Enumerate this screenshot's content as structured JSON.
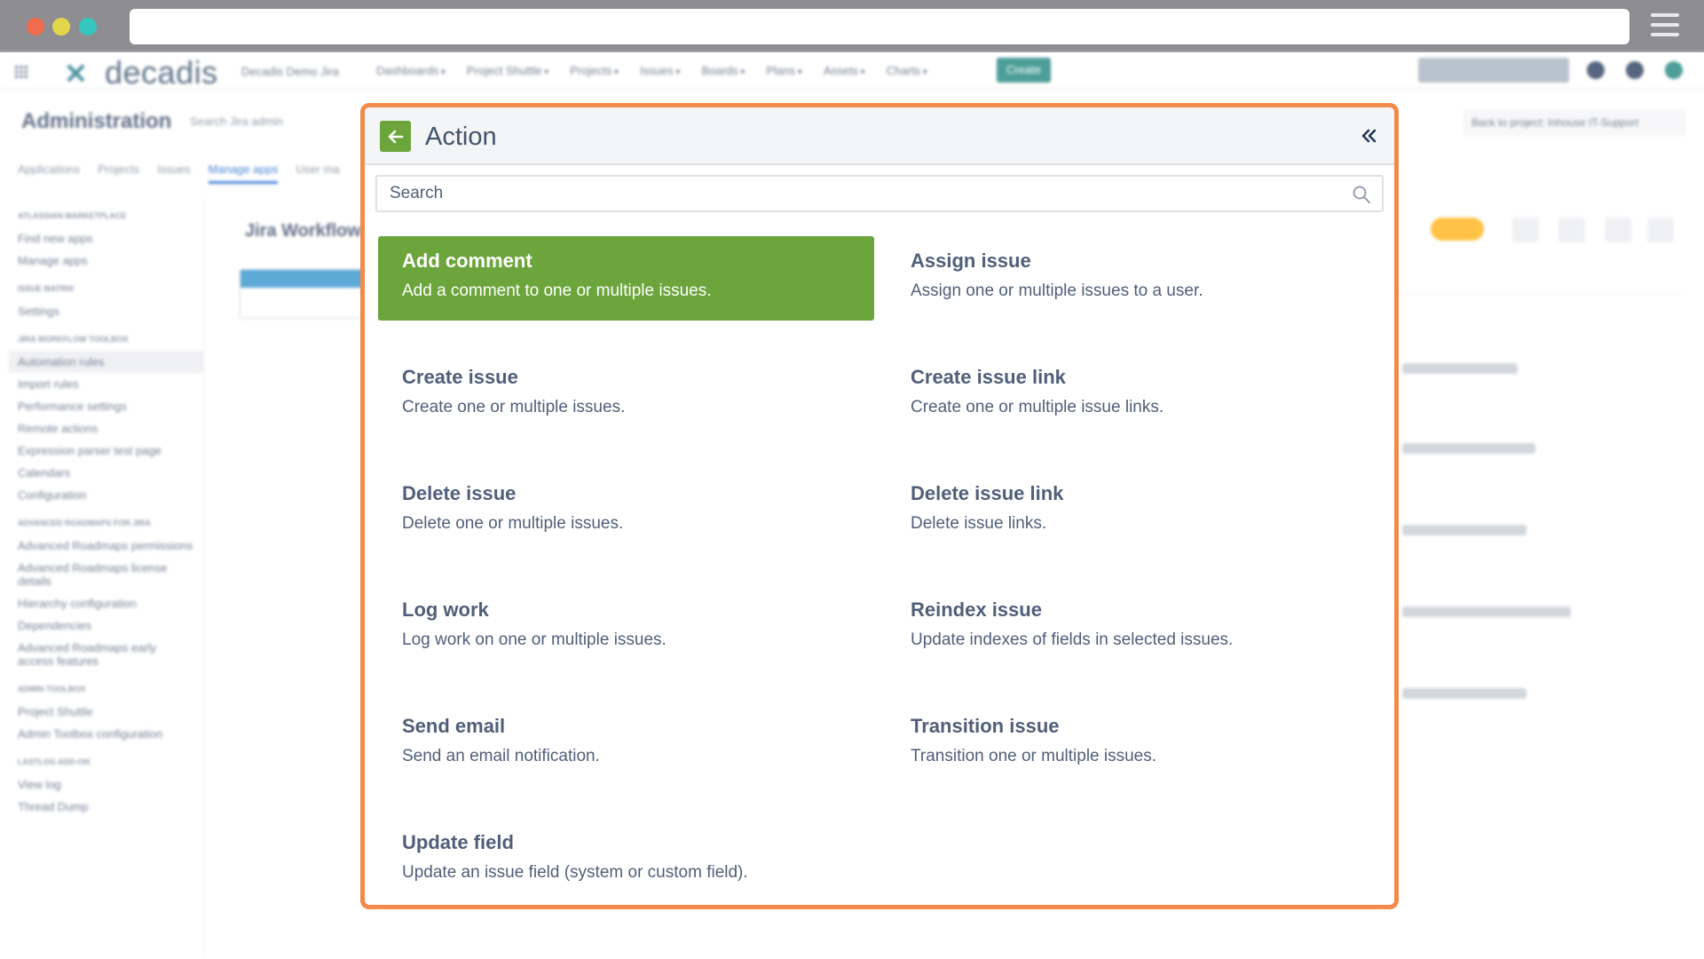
{
  "browser": {
    "window_controls": [
      "close",
      "minimize",
      "maximize"
    ],
    "url": "",
    "menu_icon": "hamburger-icon"
  },
  "background_app": {
    "logo_text": "decadis",
    "site_name": "Decadis Demo Jira",
    "nav": [
      "Dashboards",
      "Project Shuttle",
      "Projects",
      "Issues",
      "Boards",
      "Plans",
      "Assets",
      "Charts"
    ],
    "create_label": "Create",
    "admin_title": "Administration",
    "admin_search": "Search Jira admin",
    "admin_tabs": [
      "Applications",
      "Projects",
      "Issues",
      "Manage apps",
      "User ma"
    ],
    "back_to_project": "Back to project: Inhouse IT-Support",
    "workflow_title": "Jira Workflow",
    "sidebar": [
      {
        "heading": "ATLASSIAN MARKETPLACE",
        "items": [
          "Find new apps",
          "Manage apps"
        ]
      },
      {
        "heading": "ISSUE MATRIX",
        "items": [
          "Settings"
        ]
      },
      {
        "heading": "JIRA WORKFLOW TOOLBOX",
        "items": [
          "Automation rules",
          "Import rules",
          "Performance settings",
          "Remote actions",
          "Expression parser test page",
          "Calendars",
          "Configuration"
        ]
      },
      {
        "heading": "ADVANCED ROADMAPS FOR JIRA",
        "items": [
          "Advanced Roadmaps permissions",
          "Advanced Roadmaps license details",
          "Hierarchy configuration",
          "Dependencies",
          "Advanced Roadmaps early access features"
        ]
      },
      {
        "heading": "ADMIN TOOLBOX",
        "items": [
          "Project Shuttle",
          "Admin Toolbox configuration"
        ]
      },
      {
        "heading": "LASTLOG ADD-ON",
        "items": [
          "View log",
          "Thread Dump"
        ]
      }
    ]
  },
  "modal": {
    "title": "Action",
    "search_placeholder": "Search",
    "accent_color": "#6ba53b",
    "highlight_border_color": "#f28a4b",
    "actions": [
      {
        "name": "Add comment",
        "description": "Add a comment to one or multiple issues.",
        "selected": true
      },
      {
        "name": "Assign issue",
        "description": "Assign one or multiple issues to a user."
      },
      {
        "name": "Create issue",
        "description": "Create one or multiple issues."
      },
      {
        "name": "Create issue link",
        "description": "Create one or multiple issue links."
      },
      {
        "name": "Delete issue",
        "description": "Delete one or multiple issues."
      },
      {
        "name": "Delete issue link",
        "description": "Delete issue links."
      },
      {
        "name": "Log work",
        "description": "Log work on one or multiple issues."
      },
      {
        "name": "Reindex issue",
        "description": "Update indexes of fields in selected issues."
      },
      {
        "name": "Send email",
        "description": "Send an email notification."
      },
      {
        "name": "Transition issue",
        "description": "Transition one or multiple issues."
      },
      {
        "name": "Update field",
        "description": "Update an issue field (system or custom field)."
      }
    ]
  }
}
